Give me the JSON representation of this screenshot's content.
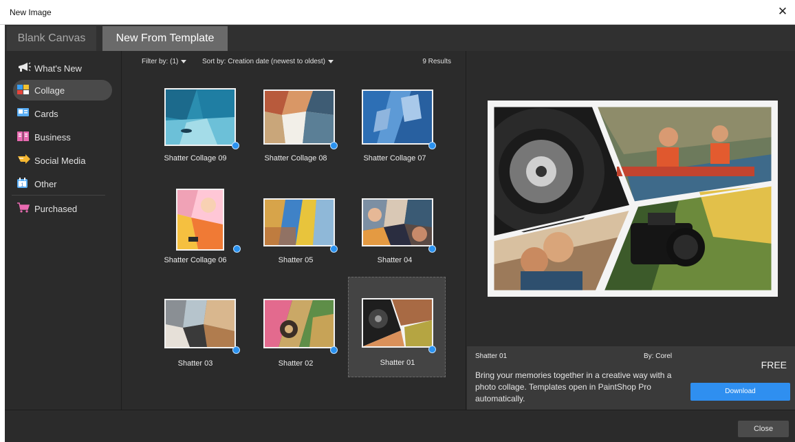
{
  "window": {
    "title": "New Image"
  },
  "tabs": [
    {
      "label": "Blank Canvas"
    },
    {
      "label": "New From Template"
    }
  ],
  "sidebar": {
    "items": [
      {
        "label": "What's New",
        "icon": "megaphone-icon"
      },
      {
        "label": "Collage",
        "icon": "collage-icon",
        "active": true
      },
      {
        "label": "Cards",
        "icon": "card-icon"
      },
      {
        "label": "Business",
        "icon": "book-icon"
      },
      {
        "label": "Social Media",
        "icon": "share-arrow-icon"
      },
      {
        "label": "Other",
        "icon": "calendar-icon"
      },
      {
        "label": "Purchased",
        "icon": "cart-icon"
      }
    ]
  },
  "toolbar": {
    "filter_label": "Filter by: (1)",
    "sort_label": "Sort by: Creation date (newest to oldest)",
    "results": "9 Results"
  },
  "templates": [
    {
      "name": "Shatter Collage 09"
    },
    {
      "name": "Shatter Collage 08"
    },
    {
      "name": "Shatter Collage 07"
    },
    {
      "name": "Shatter Collage 06"
    },
    {
      "name": "Shatter 05"
    },
    {
      "name": "Shatter 04"
    },
    {
      "name": "Shatter 03"
    },
    {
      "name": "Shatter 02"
    },
    {
      "name": "Shatter 01",
      "selected": true
    }
  ],
  "details": {
    "name": "Shatter 01",
    "author": "By: Corel",
    "price": "FREE",
    "description": "Bring your memories together in a creative way with a photo collage. Templates open in PaintShop Pro automatically.",
    "download_label": "Download"
  },
  "footer": {
    "close_label": "Close"
  },
  "colors": {
    "accent": "#2f8ff0",
    "panel": "#2b2b2b",
    "active_tab": "#6a6a6a"
  }
}
